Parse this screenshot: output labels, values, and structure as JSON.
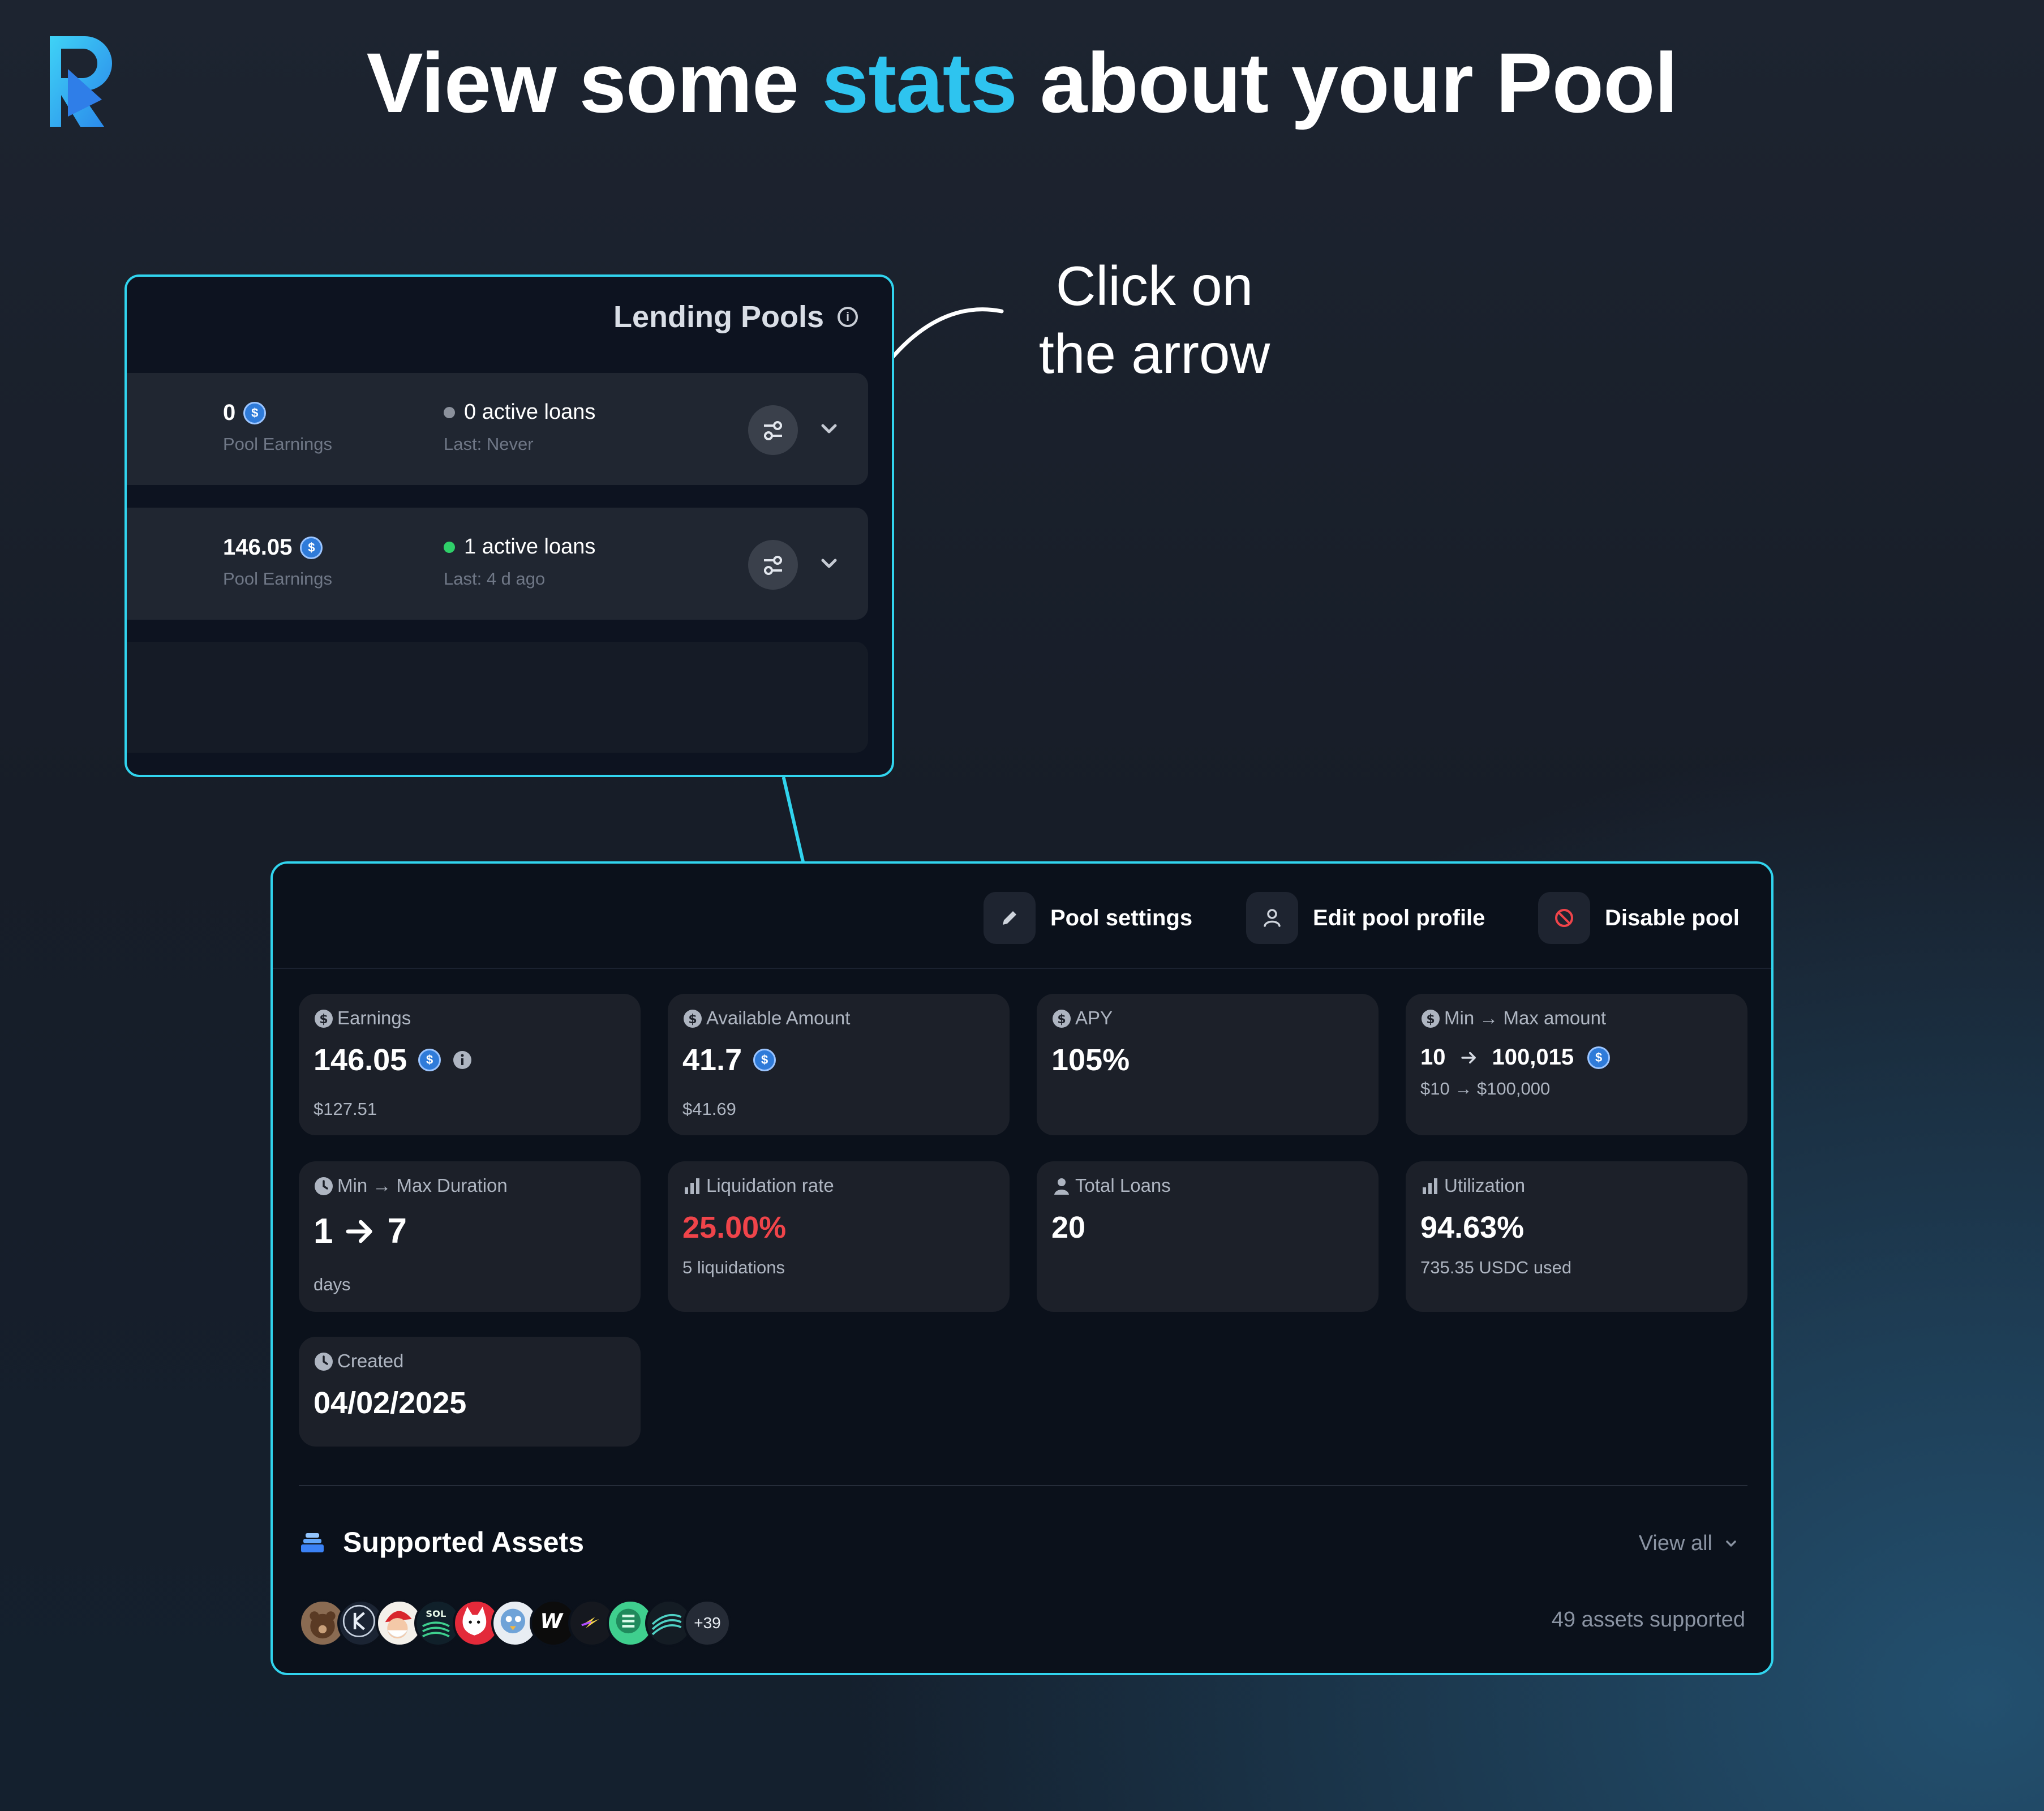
{
  "headline": {
    "part1": "View some",
    "highlight": "stats",
    "part2": "about your Pool"
  },
  "callout": {
    "line1": "Click on",
    "line2": "the arrow"
  },
  "lending_pools": {
    "title": "Lending Pools",
    "rows": [
      {
        "earnings": "0",
        "earnings_label": "Pool Earnings",
        "loans": "0 active loans",
        "last": "Last: Never",
        "status_color": "#8b919c"
      },
      {
        "earnings": "146.05",
        "earnings_label": "Pool Earnings",
        "loans": "1 active loans",
        "last": "Last: 4 d ago",
        "status_color": "#2fcf69"
      }
    ]
  },
  "pool_detail": {
    "actions": {
      "settings": "Pool settings",
      "edit_profile": "Edit pool profile",
      "disable": "Disable pool"
    },
    "stats": {
      "earnings": {
        "label": "Earnings",
        "value": "146.05",
        "sub": "$127.51"
      },
      "available": {
        "label": "Available Amount",
        "value": "41.7",
        "sub": "$41.69"
      },
      "apy": {
        "label": "APY",
        "value": "105%"
      },
      "minmax_amount": {
        "label": "Min → Max amount",
        "min": "10",
        "max": "100,015",
        "sub": "$10 → $100,000"
      },
      "duration": {
        "label": "Min → Max Duration",
        "min": "1",
        "max": "7",
        "sub": "days"
      },
      "liquidation": {
        "label": "Liquidation rate",
        "value": "25.00%",
        "sub": "5 liquidations",
        "color": "#f0444a"
      },
      "total_loans": {
        "label": "Total Loans",
        "value": "20"
      },
      "utilization": {
        "label": "Utilization",
        "value": "94.63%",
        "sub": "735.35 USDC used"
      },
      "created": {
        "label": "Created",
        "value": "04/02/2025"
      }
    },
    "supported_assets": {
      "title": "Supported Assets",
      "view_all": "View all",
      "more": "+39",
      "count_text": "49 assets supported",
      "token_icons": [
        "bear-token-icon",
        "kamino-token-icon",
        "santa-token-icon",
        "sol-token-icon",
        "cat-token-icon",
        "bird-token-icon",
        "w-token-icon",
        "jupiter-token-icon",
        "e-token-icon",
        "solana-token-icon"
      ]
    }
  },
  "colors": {
    "accent": "#2ec4ef",
    "border": "#31d4ee",
    "usdc": "#2f7bd9"
  }
}
